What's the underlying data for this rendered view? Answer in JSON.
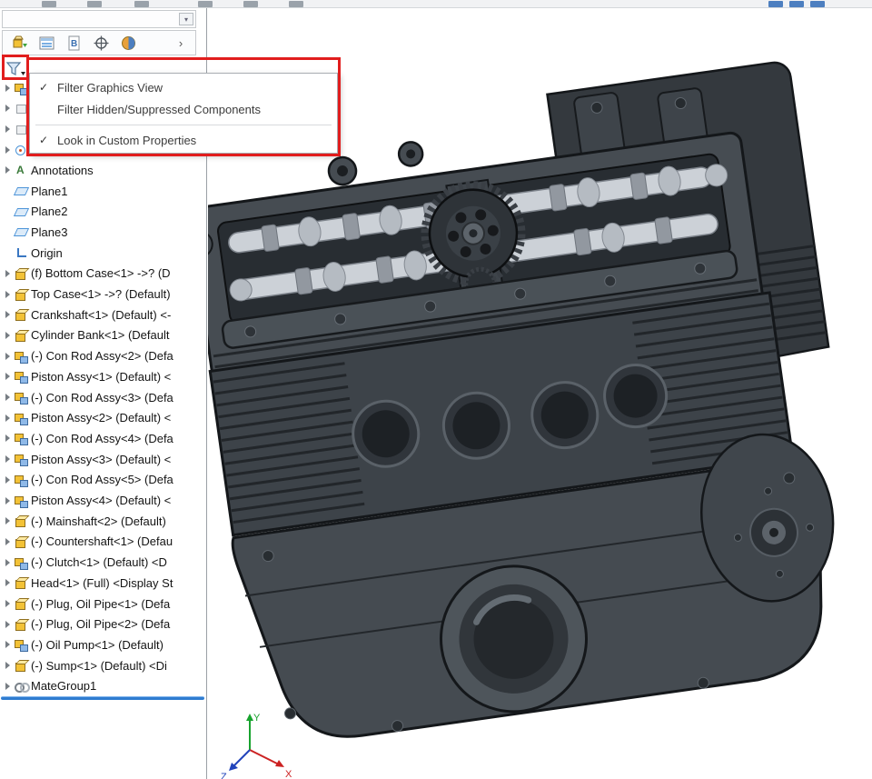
{
  "colors": {
    "highlight_red": "#e11d1d",
    "rollback_blue": "#2f7cd0",
    "component_gold": "#f3c236",
    "accent_blue": "#4d94d8",
    "engine_gray": "#464c52"
  },
  "panel": {
    "tabs": [
      "feature-tree-icon",
      "property-manager-icon",
      "configuration-manager-icon",
      "dimxpert-icon",
      "display-manager-icon"
    ],
    "expand_arrow": "›",
    "filter_button_icon": "filter-funnel-icon"
  },
  "filter_menu": {
    "items": [
      {
        "label": "Filter Graphics View",
        "checked": true
      },
      {
        "label": "Filter Hidden/Suppressed Components",
        "checked": false
      },
      {
        "label": "Look in Custom Properties",
        "checked": true
      }
    ],
    "check_glyph": "✓"
  },
  "tree": {
    "items": [
      {
        "label": "",
        "icon": "asm",
        "arrow": true
      },
      {
        "label": "",
        "icon": "folder",
        "arrow": true
      },
      {
        "label": "",
        "icon": "folder",
        "arrow": true
      },
      {
        "label": "Sensors",
        "icon": "sensors",
        "arrow": true
      },
      {
        "label": "Annotations",
        "icon": "annotations",
        "arrow": true
      },
      {
        "label": "Plane1",
        "icon": "plane",
        "arrow": false
      },
      {
        "label": "Plane2",
        "icon": "plane",
        "arrow": false
      },
      {
        "label": "Plane3",
        "icon": "plane",
        "arrow": false
      },
      {
        "label": "Origin",
        "icon": "origin",
        "arrow": false
      },
      {
        "label": "(f) Bottom Case<1> ->? (D",
        "icon": "part",
        "arrow": true
      },
      {
        "label": "Top Case<1> ->? (Default)",
        "icon": "part",
        "arrow": true
      },
      {
        "label": "Crankshaft<1> (Default) <-",
        "icon": "part",
        "arrow": true
      },
      {
        "label": "Cylinder Bank<1> (Default",
        "icon": "part",
        "arrow": true
      },
      {
        "label": "(-) Con Rod Assy<2> (Defa",
        "icon": "asm",
        "arrow": true
      },
      {
        "label": "Piston Assy<1> (Default) <",
        "icon": "asm",
        "arrow": true
      },
      {
        "label": "(-) Con Rod Assy<3> (Defa",
        "icon": "asm",
        "arrow": true
      },
      {
        "label": "Piston Assy<2> (Default) <",
        "icon": "asm",
        "arrow": true
      },
      {
        "label": "(-) Con Rod Assy<4> (Defa",
        "icon": "asm",
        "arrow": true
      },
      {
        "label": "Piston Assy<3> (Default) <",
        "icon": "asm",
        "arrow": true
      },
      {
        "label": "(-) Con Rod Assy<5> (Defa",
        "icon": "asm",
        "arrow": true
      },
      {
        "label": "Piston Assy<4> (Default) <",
        "icon": "asm",
        "arrow": true
      },
      {
        "label": "(-) Mainshaft<2> (Default)",
        "icon": "part",
        "arrow": true
      },
      {
        "label": "(-) Countershaft<1> (Defau",
        "icon": "part",
        "arrow": true
      },
      {
        "label": "(-) Clutch<1> (Default) <D",
        "icon": "asm",
        "arrow": true
      },
      {
        "label": "Head<1> (Full) <Display St",
        "icon": "part",
        "arrow": true
      },
      {
        "label": "(-) Plug, Oil Pipe<1> (Defa",
        "icon": "part",
        "arrow": true
      },
      {
        "label": "(-) Plug, Oil Pipe<2> (Defa",
        "icon": "part",
        "arrow": true
      },
      {
        "label": "(-) Oil Pump<1> (Default)",
        "icon": "asm",
        "arrow": true
      },
      {
        "label": "(-) Sump<1> (Default) <Di",
        "icon": "part",
        "arrow": true
      },
      {
        "label": "MateGroup1",
        "icon": "mategroup",
        "arrow": true
      }
    ]
  },
  "viewport": {
    "triad": {
      "x": "X",
      "y": "Y",
      "z": "Z"
    }
  }
}
